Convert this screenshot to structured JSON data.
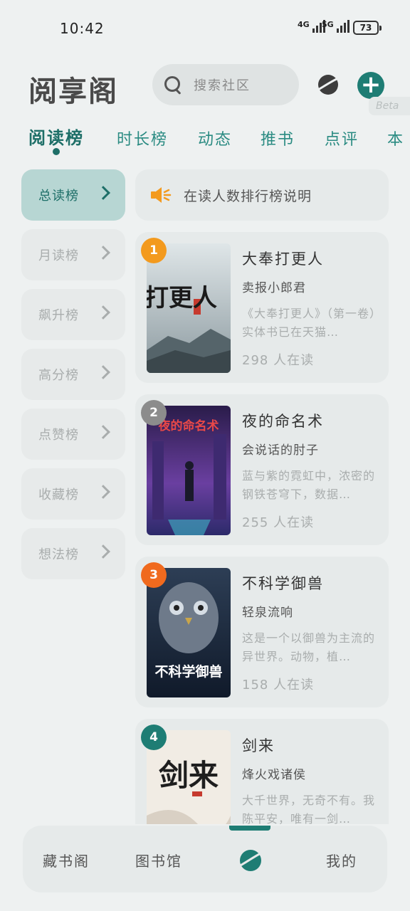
{
  "status_bar": {
    "time": "10:42",
    "net1": "4G",
    "net2": "5G",
    "battery": "73"
  },
  "header": {
    "app_title": "阅享阁",
    "search_placeholder": "搜索社区",
    "beta_label": "Beta",
    "accent_color": "#1e7d74"
  },
  "tabs": [
    "阅读榜",
    "时长榜",
    "动态",
    "推书",
    "点评",
    "本"
  ],
  "side_menu": [
    {
      "label": "总读榜",
      "active": true
    },
    {
      "label": "月读榜",
      "active": false
    },
    {
      "label": "飙升榜",
      "active": false
    },
    {
      "label": "高分榜",
      "active": false
    },
    {
      "label": "点赞榜",
      "active": false
    },
    {
      "label": "收藏榜",
      "active": false
    },
    {
      "label": "想法榜",
      "active": false
    }
  ],
  "notice": {
    "icon": "speaker-icon",
    "text": "在读人数排行榜说明"
  },
  "books": [
    {
      "rank": "1",
      "rank_color": "#f39a1e",
      "title": "大奉打更人",
      "author": "卖报小郎君",
      "desc": "《大奉打更人》（第一卷）实体书已在天猫…",
      "readers": "298 人在读",
      "cover_text": "打更人"
    },
    {
      "rank": "2",
      "rank_color": "#8c8c8c",
      "title": "夜的命名术",
      "author": "会说话的肘子",
      "desc": "蓝与紫的霓虹中，浓密的钢铁苍穹下，数据…",
      "readers": "255 人在读",
      "cover_text": "夜的命名术"
    },
    {
      "rank": "3",
      "rank_color": "#f06a1e",
      "title": "不科学御兽",
      "author": "轻泉流响",
      "desc": "这是一个以御兽为主流的异世界。动物，植…",
      "readers": "158 人在读",
      "cover_text": "不科学御兽"
    },
    {
      "rank": "4",
      "rank_color": "#1e7d74",
      "title": "剑来",
      "author": "烽火戏诸侯",
      "desc": "大千世界，无奇不有。我陈平安，唯有一剑…",
      "readers": "",
      "cover_text": "剑来"
    }
  ],
  "bottom_nav": {
    "items": [
      "藏书阁",
      "图书馆",
      "我的"
    ],
    "center_icon": "planet-icon"
  }
}
